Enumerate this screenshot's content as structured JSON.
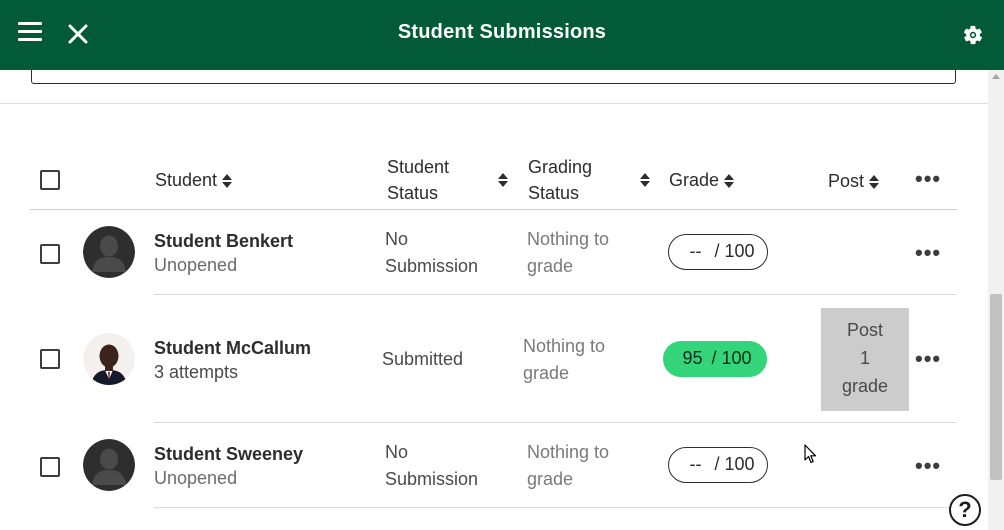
{
  "header": {
    "title": "Student Submissions",
    "menu_icon": "hamburger-menu-icon",
    "close_icon": "close-icon",
    "settings_icon": "gear-icon"
  },
  "table": {
    "columns": {
      "student": "Student",
      "student_status_line1": "Student",
      "student_status_line2": "Status",
      "grading_status_line1": "Grading",
      "grading_status_line2": "Status",
      "grade": "Grade",
      "post": "Post",
      "more": "•••"
    },
    "rows": [
      {
        "name": "Student Benkert",
        "detail": "Unopened",
        "status_line1": "No",
        "status_line2": "Submission",
        "grading_line1": "Nothing to",
        "grading_line2": "grade",
        "grade_value": "--",
        "grade_max": "/ 100",
        "more": "•••"
      },
      {
        "name": "Student McCallum",
        "detail": "3 attempts",
        "status_line1": "Submitted",
        "grading_line1": "Nothing to",
        "grading_line2": "grade",
        "grade_value": "95",
        "grade_max": "/ 100",
        "post_line1": "Post",
        "post_line2": "1",
        "post_line3": "grade",
        "more": "•••"
      },
      {
        "name": "Student Sweeney",
        "detail": "Unopened",
        "status_line1": "No",
        "status_line2": "Submission",
        "grading_line1": "Nothing to",
        "grading_line2": "grade",
        "grade_value": "--",
        "grade_max": "/ 100",
        "more": "•••"
      }
    ]
  },
  "help": {
    "label": "?",
    "icon": "help-icon"
  },
  "colors": {
    "header_bg": "#035a39",
    "graded_pill": "#34d57a",
    "post_button": "#cccccc"
  }
}
